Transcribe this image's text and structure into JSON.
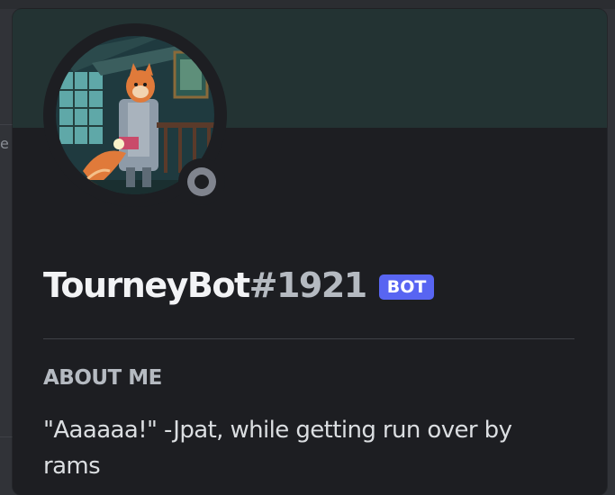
{
  "background": {
    "partial_text": "e"
  },
  "profile": {
    "username": "TourneyBot",
    "discriminator": "#1921",
    "bot_tag": "BOT",
    "status": "offline",
    "avatar_icon": "fox-character-avatar-icon",
    "status_icon": "offline-status-icon",
    "banner_color": "#233333"
  },
  "about": {
    "title": "ABOUT ME",
    "text": "\"Aaaaaa!\" -Jpat, while getting run over by rams"
  },
  "colors": {
    "accent": "#5865f2",
    "popout_bg": "#1d1e22",
    "status_offline": "#80848e"
  }
}
